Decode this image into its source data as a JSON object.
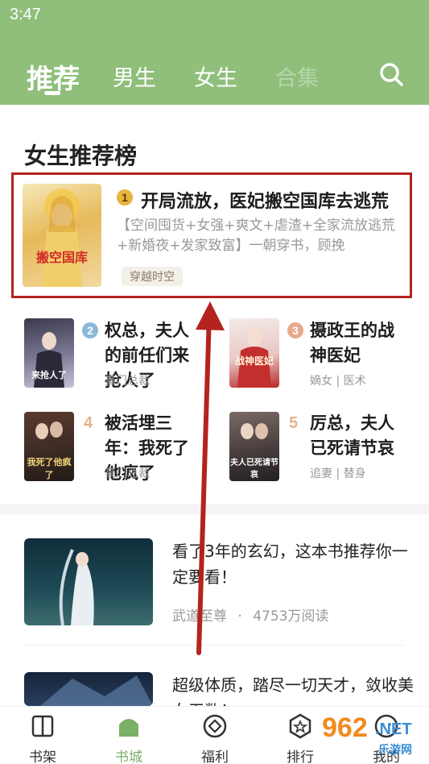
{
  "status": {
    "time": "3:47"
  },
  "tabs": [
    {
      "label": "推荐",
      "active": true
    },
    {
      "label": "男生"
    },
    {
      "label": "女生"
    },
    {
      "label": "合集"
    }
  ],
  "icons": {
    "search": "search-icon"
  },
  "section_title": "女生推荐榜",
  "ranking": {
    "featured": {
      "rank": "1",
      "title": "开局流放，医妃搬空国库去逃荒",
      "description": "【空间囤货+女强+爽文+虐渣+全家流放逃荒+新婚夜+发家致富】一朝穿书，顾挽",
      "tag": "穿越时空",
      "cover_text": "搬空国库"
    },
    "items": [
      {
        "rank": "2",
        "title": "权总，夫人的前任们来抢人了",
        "tags": "豪门总裁",
        "cover_text": "来抢人了"
      },
      {
        "rank": "3",
        "title": "摄政王的战神医妃",
        "tags": "嫡女 | 医术",
        "cover_text": "战神医妃"
      },
      {
        "rank": "4",
        "title": "被活埋三年：我死了他疯了",
        "tags": "豪门总裁",
        "cover_text": "我死了他疯了"
      },
      {
        "rank": "5",
        "title": "厉总，夫人已死请节哀",
        "tags": "追妻 | 替身",
        "cover_text": "夫人已死请节哀"
      }
    ]
  },
  "feed": [
    {
      "title": "看了3年的玄幻，这本书推荐你一定要看！",
      "book": "武道至尊",
      "dot": "·",
      "reads": "4753万阅读"
    },
    {
      "title": "超级体质，踏尽一切天才，敛收美女无数！"
    }
  ],
  "bottom_nav": [
    {
      "label": "书架",
      "icon": "book-icon"
    },
    {
      "label": "书城",
      "icon": "home-icon",
      "active": true
    },
    {
      "label": "福利",
      "icon": "gift-icon"
    },
    {
      "label": "排行",
      "icon": "star-badge-icon"
    },
    {
      "label": "我的",
      "icon": "profile-icon"
    }
  ],
  "watermark": {
    "num": "962",
    "dot": ".NET",
    "sub": "乐游网"
  },
  "colors": {
    "header": "#8fbf7b",
    "highlight": "#b4231f",
    "accent": "#7bb067"
  }
}
